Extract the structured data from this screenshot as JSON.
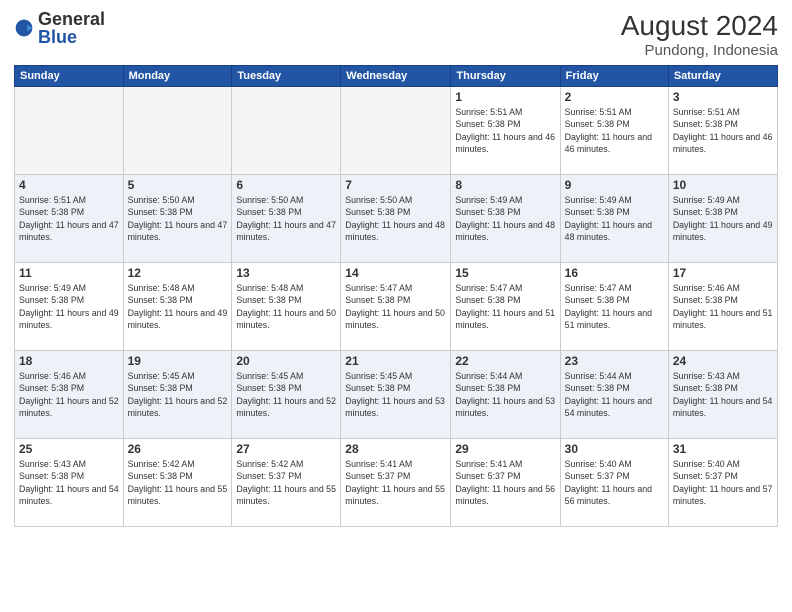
{
  "logo": {
    "general": "General",
    "blue": "Blue"
  },
  "header": {
    "month_year": "August 2024",
    "location": "Pundong, Indonesia"
  },
  "days_of_week": [
    "Sunday",
    "Monday",
    "Tuesday",
    "Wednesday",
    "Thursday",
    "Friday",
    "Saturday"
  ],
  "weeks": [
    [
      {
        "day": "",
        "empty": true
      },
      {
        "day": "",
        "empty": true
      },
      {
        "day": "",
        "empty": true
      },
      {
        "day": "",
        "empty": true
      },
      {
        "day": "1",
        "sunrise": "5:51 AM",
        "sunset": "5:38 PM",
        "daylight": "11 hours and 46 minutes."
      },
      {
        "day": "2",
        "sunrise": "5:51 AM",
        "sunset": "5:38 PM",
        "daylight": "11 hours and 46 minutes."
      },
      {
        "day": "3",
        "sunrise": "5:51 AM",
        "sunset": "5:38 PM",
        "daylight": "11 hours and 46 minutes."
      }
    ],
    [
      {
        "day": "4",
        "sunrise": "5:51 AM",
        "sunset": "5:38 PM",
        "daylight": "11 hours and 47 minutes."
      },
      {
        "day": "5",
        "sunrise": "5:50 AM",
        "sunset": "5:38 PM",
        "daylight": "11 hours and 47 minutes."
      },
      {
        "day": "6",
        "sunrise": "5:50 AM",
        "sunset": "5:38 PM",
        "daylight": "11 hours and 47 minutes."
      },
      {
        "day": "7",
        "sunrise": "5:50 AM",
        "sunset": "5:38 PM",
        "daylight": "11 hours and 48 minutes."
      },
      {
        "day": "8",
        "sunrise": "5:49 AM",
        "sunset": "5:38 PM",
        "daylight": "11 hours and 48 minutes."
      },
      {
        "day": "9",
        "sunrise": "5:49 AM",
        "sunset": "5:38 PM",
        "daylight": "11 hours and 48 minutes."
      },
      {
        "day": "10",
        "sunrise": "5:49 AM",
        "sunset": "5:38 PM",
        "daylight": "11 hours and 49 minutes."
      }
    ],
    [
      {
        "day": "11",
        "sunrise": "5:49 AM",
        "sunset": "5:38 PM",
        "daylight": "11 hours and 49 minutes."
      },
      {
        "day": "12",
        "sunrise": "5:48 AM",
        "sunset": "5:38 PM",
        "daylight": "11 hours and 49 minutes."
      },
      {
        "day": "13",
        "sunrise": "5:48 AM",
        "sunset": "5:38 PM",
        "daylight": "11 hours and 50 minutes."
      },
      {
        "day": "14",
        "sunrise": "5:47 AM",
        "sunset": "5:38 PM",
        "daylight": "11 hours and 50 minutes."
      },
      {
        "day": "15",
        "sunrise": "5:47 AM",
        "sunset": "5:38 PM",
        "daylight": "11 hours and 51 minutes."
      },
      {
        "day": "16",
        "sunrise": "5:47 AM",
        "sunset": "5:38 PM",
        "daylight": "11 hours and 51 minutes."
      },
      {
        "day": "17",
        "sunrise": "5:46 AM",
        "sunset": "5:38 PM",
        "daylight": "11 hours and 51 minutes."
      }
    ],
    [
      {
        "day": "18",
        "sunrise": "5:46 AM",
        "sunset": "5:38 PM",
        "daylight": "11 hours and 52 minutes."
      },
      {
        "day": "19",
        "sunrise": "5:45 AM",
        "sunset": "5:38 PM",
        "daylight": "11 hours and 52 minutes."
      },
      {
        "day": "20",
        "sunrise": "5:45 AM",
        "sunset": "5:38 PM",
        "daylight": "11 hours and 52 minutes."
      },
      {
        "day": "21",
        "sunrise": "5:45 AM",
        "sunset": "5:38 PM",
        "daylight": "11 hours and 53 minutes."
      },
      {
        "day": "22",
        "sunrise": "5:44 AM",
        "sunset": "5:38 PM",
        "daylight": "11 hours and 53 minutes."
      },
      {
        "day": "23",
        "sunrise": "5:44 AM",
        "sunset": "5:38 PM",
        "daylight": "11 hours and 54 minutes."
      },
      {
        "day": "24",
        "sunrise": "5:43 AM",
        "sunset": "5:38 PM",
        "daylight": "11 hours and 54 minutes."
      }
    ],
    [
      {
        "day": "25",
        "sunrise": "5:43 AM",
        "sunset": "5:38 PM",
        "daylight": "11 hours and 54 minutes."
      },
      {
        "day": "26",
        "sunrise": "5:42 AM",
        "sunset": "5:38 PM",
        "daylight": "11 hours and 55 minutes."
      },
      {
        "day": "27",
        "sunrise": "5:42 AM",
        "sunset": "5:37 PM",
        "daylight": "11 hours and 55 minutes."
      },
      {
        "day": "28",
        "sunrise": "5:41 AM",
        "sunset": "5:37 PM",
        "daylight": "11 hours and 55 minutes."
      },
      {
        "day": "29",
        "sunrise": "5:41 AM",
        "sunset": "5:37 PM",
        "daylight": "11 hours and 56 minutes."
      },
      {
        "day": "30",
        "sunrise": "5:40 AM",
        "sunset": "5:37 PM",
        "daylight": "11 hours and 56 minutes."
      },
      {
        "day": "31",
        "sunrise": "5:40 AM",
        "sunset": "5:37 PM",
        "daylight": "11 hours and 57 minutes."
      }
    ]
  ]
}
